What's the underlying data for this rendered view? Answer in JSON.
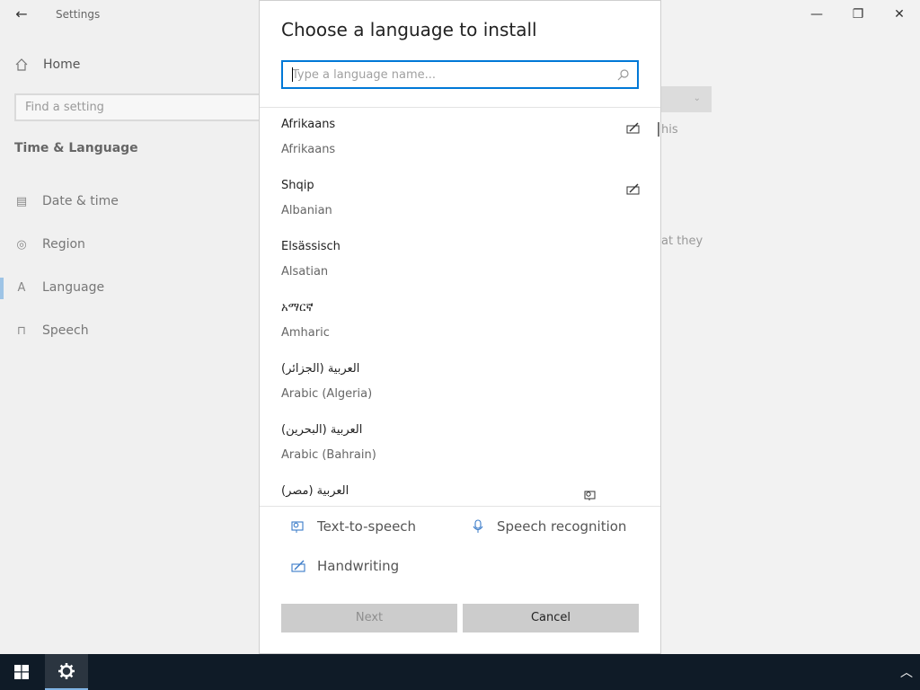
{
  "settings": {
    "window_title": "Settings",
    "home": "Home",
    "find_placeholder": "Find a setting",
    "section": "Time & Language",
    "nav": [
      {
        "label": "Date & time",
        "icon": "calendar-clock-icon"
      },
      {
        "label": "Region",
        "icon": "globe-icon"
      },
      {
        "label": "Language",
        "icon": "language-icon",
        "selected": true
      },
      {
        "label": "Speech",
        "icon": "microphone-icon"
      }
    ],
    "fragment_1": "his",
    "fragment_2": "at they"
  },
  "dialog": {
    "title": "Choose a language to install",
    "search_placeholder": "Type a language name...",
    "languages": [
      {
        "native": "Afrikaans",
        "english": "Afrikaans",
        "features": [
          "handwriting-icon"
        ]
      },
      {
        "native": "Shqip",
        "english": "Albanian",
        "features": [
          "handwriting-icon"
        ]
      },
      {
        "native": "Elsässisch",
        "english": "Alsatian",
        "features": []
      },
      {
        "native": "አማርኛ",
        "english": "Amharic",
        "features": []
      },
      {
        "native": "العربية (الجزائر)",
        "english": "Arabic (Algeria)",
        "features": []
      },
      {
        "native": "العربية (البحرين)",
        "english": "Arabic (Bahrain)",
        "features": []
      },
      {
        "native": "العربية (مصر)",
        "english": "",
        "features": [
          "text-to-speech-icon"
        ]
      }
    ],
    "legend": {
      "tts": "Text-to-speech",
      "speech": "Speech recognition",
      "handwriting": "Handwriting"
    },
    "next_button": "Next",
    "cancel_button": "Cancel"
  },
  "colors": {
    "accent": "#0078d7",
    "taskbar": "#0f1b27",
    "button": "#cccccc"
  }
}
